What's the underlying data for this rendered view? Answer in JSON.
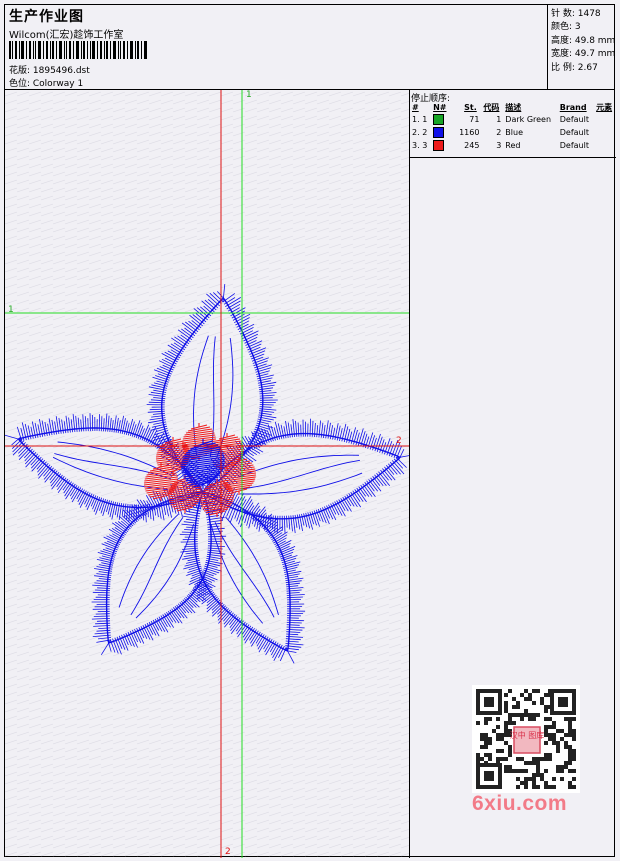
{
  "header": {
    "title": "生产作业图",
    "company": "Wilcom(汇宏)趁饰工作室",
    "design_label": "花版: 1895496.dst",
    "colorway_label": "色位: Colorway 1"
  },
  "stats": {
    "stitches": "针 数: 1478",
    "colors": "颜色: 3",
    "height": "高度: 49.8 mm",
    "width": "宽度: 49.7 mm",
    "scale": "比 例: 2.67"
  },
  "stop_sequence": {
    "title": "停止顺序:",
    "headers": [
      "#",
      "N#",
      "St.",
      "代码",
      "描述",
      "Brand",
      "元素"
    ],
    "rows": [
      {
        "index": "1.",
        "n": "1",
        "color": "#17a526",
        "stitches": "71",
        "code": "1",
        "description": "Dark Green",
        "brand": "Default",
        "element": ""
      },
      {
        "index": "2.",
        "n": "2",
        "color": "#1010e8",
        "stitches": "1160",
        "code": "2",
        "description": "Blue",
        "brand": "Default",
        "element": ""
      },
      {
        "index": "3.",
        "n": "3",
        "color": "#ee1c1c",
        "stitches": "245",
        "code": "3",
        "description": "Red",
        "brand": "Default",
        "element": ""
      }
    ]
  },
  "axes": {
    "top_label": "1",
    "left_label": "1",
    "right_label": "2",
    "bottom_label": "2"
  },
  "colors": {
    "stitch_blue": "#1010e8",
    "stitch_red": "#ee1c1c",
    "guide_green": "#22dd22",
    "guide_red": "#dd1111"
  },
  "watermark": "6xiu.com",
  "qr_badge": "汉中 图库"
}
